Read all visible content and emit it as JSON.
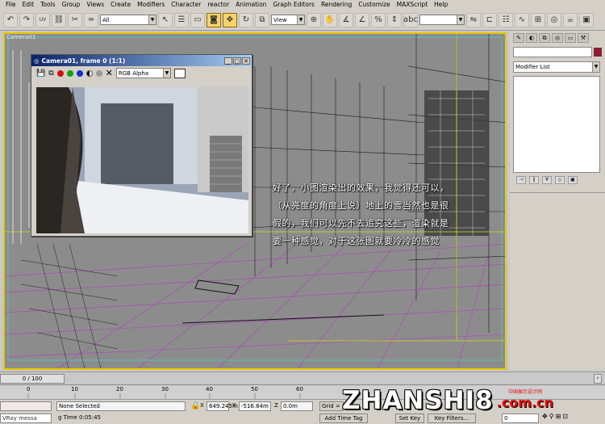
{
  "menu": [
    "File",
    "Edit",
    "Tools",
    "Group",
    "Views",
    "Create",
    "Modifiers",
    "Character",
    "reactor",
    "Animation",
    "Graph Editors",
    "Rendering",
    "Customize",
    "MAXScript",
    "Help"
  ],
  "toolbar": {
    "selection_filter": "All",
    "reference_coord": "View",
    "named_selection": ""
  },
  "viewport": {
    "label": "Camera01"
  },
  "camera_window": {
    "title": "Camera01, frame 0 (1:1)",
    "channel": "RGB Alpha",
    "controls": [
      {
        "name": "red",
        "color": "#d01010"
      },
      {
        "name": "green",
        "color": "#10a010"
      },
      {
        "name": "blue",
        "color": "#1030d0"
      }
    ]
  },
  "overlay_text": [
    "好了，小图渲染出的效果，我觉得还可以，",
    "（从亮度的角度上说）地上的雪当然也是很",
    "假的，我们可以先不去追究这些，渲染就是",
    "要一种感觉，对于这张图就要冷冷的感觉"
  ],
  "command_panel": {
    "modifier_list": "Modifier List",
    "accent": "#8a2031"
  },
  "timeline": {
    "slider": "0 / 100",
    "ticks": [
      "0",
      "10",
      "20",
      "30",
      "40",
      "50",
      "60"
    ]
  },
  "status": {
    "selection": "None Selected",
    "x": "649.245m",
    "y": "-516.84m",
    "z": "0.0m",
    "grid": "Grid = ",
    "time_label": "g Time  0:05:45",
    "maxscript": "VRay messa",
    "add_time_tag": "Add Time Tag",
    "set_key": "Set Key",
    "key_filters": "Key Filters...",
    "frame": "0"
  },
  "watermark": {
    "main": "ZHANSHI8",
    "domain": ".com.cn",
    "sub": "中国展示设计网"
  }
}
